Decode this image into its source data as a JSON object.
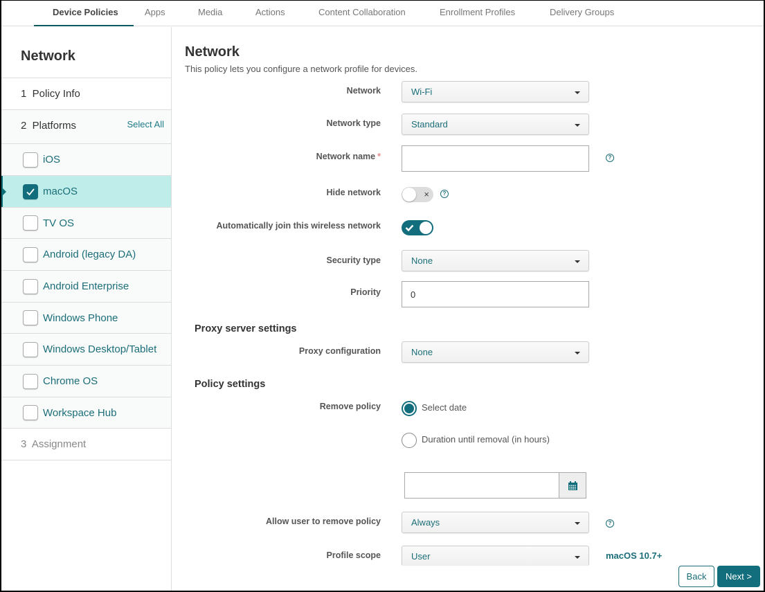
{
  "topnav": {
    "tabs": [
      {
        "label": "Device Policies",
        "active": true
      },
      {
        "label": "Apps",
        "active": false
      },
      {
        "label": "Media",
        "active": false
      },
      {
        "label": "Actions",
        "active": false
      },
      {
        "label": "Content Collaboration",
        "active": false
      },
      {
        "label": "Enrollment Profiles",
        "active": false
      },
      {
        "label": "Delivery Groups",
        "active": false
      }
    ]
  },
  "sidebar": {
    "title": "Network",
    "steps": [
      {
        "label": "1  Policy Info"
      },
      {
        "label": "2  Platforms",
        "select_all": "Select All"
      },
      {
        "label": "3  Assignment"
      }
    ],
    "platforms": [
      {
        "label": "iOS",
        "checked": false
      },
      {
        "label": "macOS",
        "checked": true
      },
      {
        "label": "TV OS",
        "checked": false
      },
      {
        "label": "Android (legacy DA)",
        "checked": false
      },
      {
        "label": "Android Enterprise",
        "checked": false
      },
      {
        "label": "Windows Phone",
        "checked": false
      },
      {
        "label": "Windows Desktop/Tablet",
        "checked": false
      },
      {
        "label": "Chrome OS",
        "checked": false
      },
      {
        "label": "Workspace Hub",
        "checked": false
      }
    ]
  },
  "main": {
    "title": "Network",
    "description": "This policy lets you configure a network profile for devices.",
    "fields": {
      "network": {
        "label": "Network",
        "value": "Wi-Fi"
      },
      "network_type": {
        "label": "Network type",
        "value": "Standard"
      },
      "network_name": {
        "label": "Network name",
        "required_mark": "*",
        "value": ""
      },
      "hide_network": {
        "label": "Hide network",
        "enabled": false,
        "off_glyph": "×"
      },
      "auto_join": {
        "label": "Automatically join this wireless network",
        "enabled": true
      },
      "security_type": {
        "label": "Security type",
        "value": "None"
      },
      "priority": {
        "label": "Priority",
        "value": "0"
      }
    },
    "proxy_section": {
      "title": "Proxy server settings",
      "proxy_configuration": {
        "label": "Proxy configuration",
        "value": "None"
      }
    },
    "policy_section": {
      "title": "Policy settings",
      "remove_policy": {
        "label": "Remove policy",
        "options": [
          {
            "label": "Select date",
            "selected": true
          },
          {
            "label": "Duration until removal (in hours)",
            "selected": false
          }
        ],
        "date_value": ""
      },
      "allow_user_remove": {
        "label": "Allow user to remove policy",
        "value": "Always"
      },
      "profile_scope": {
        "label": "Profile scope",
        "value": "User",
        "note": "macOS 10.7+"
      }
    },
    "help_glyph": "?"
  },
  "footer": {
    "back_label": "Back",
    "next_label": "Next >"
  },
  "colors": {
    "accent": "#126e7c",
    "link": "#1b6e78",
    "selected_row": "#bfeeea",
    "required": "#e58b8b"
  }
}
